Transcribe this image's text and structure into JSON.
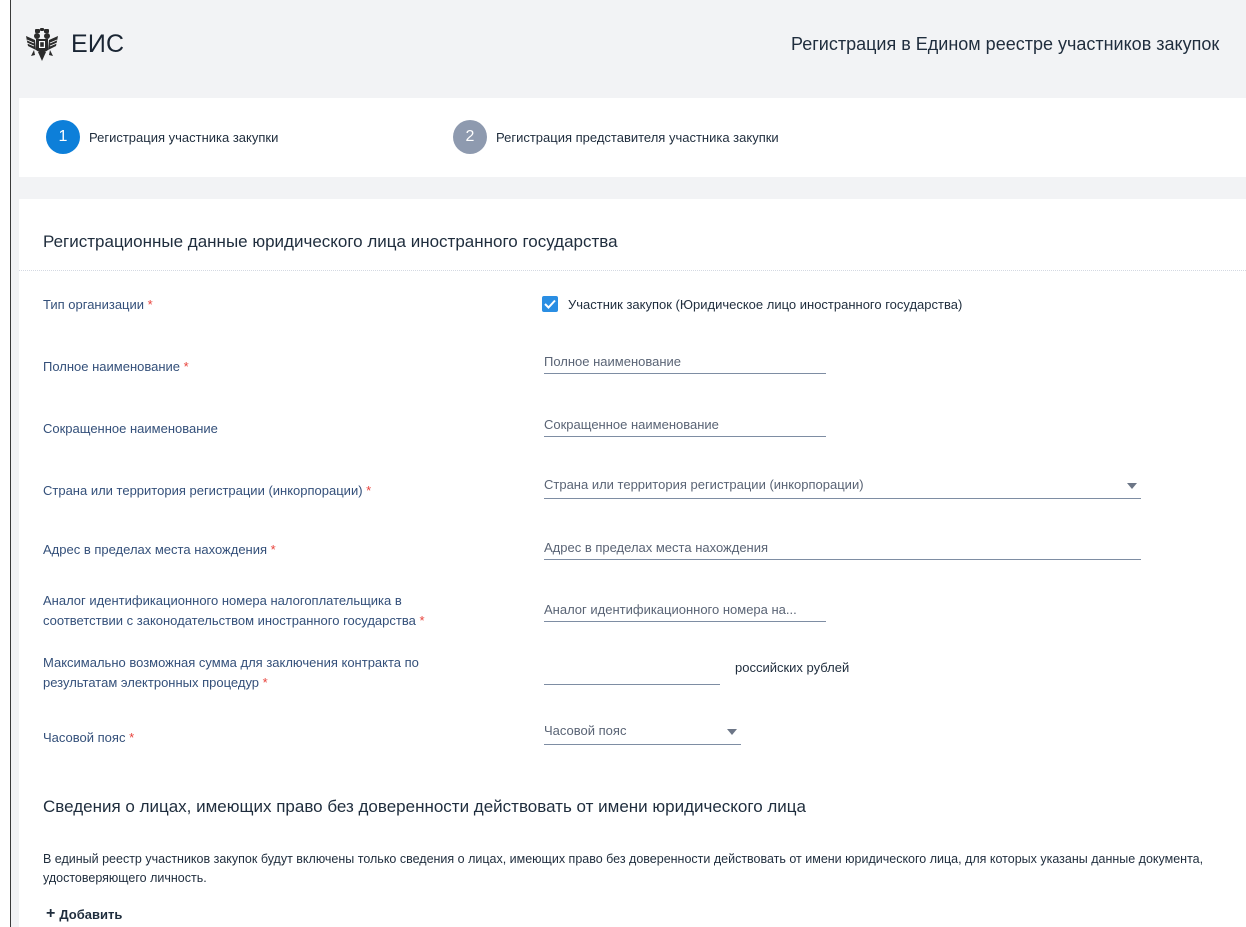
{
  "header": {
    "brand": "ЕИС",
    "page_title": "Регистрация в Едином реестре участников закупок",
    "logo_icon": "double-eagle-emblem-icon"
  },
  "steps": [
    {
      "number": "1",
      "label": "Регистрация участника закупки",
      "active": true
    },
    {
      "number": "2",
      "label": "Регистрация представителя участника закупки",
      "active": false
    }
  ],
  "form": {
    "section_title": "Регистрационные данные юридического лица иностранного государства",
    "required_mark": "*",
    "org_type": {
      "label": "Тип организации",
      "checkbox_label": "Участник закупок (Юридическое лицо иностранного государства)",
      "checked": true
    },
    "full_name": {
      "label": "Полное наименование",
      "placeholder": "Полное наименование"
    },
    "short_name": {
      "label": "Сокращенное наименование",
      "placeholder": "Сокращенное наименование"
    },
    "country": {
      "label": "Страна или территория регистрации (инкорпорации)",
      "placeholder": "Страна или территория регистрации (инкорпорации)"
    },
    "address": {
      "label": "Адрес в пределах места нахождения",
      "placeholder": "Адрес в пределах места нахождения"
    },
    "tax_id": {
      "label_line1": "Аналог идентификационного номера налогоплательщика в",
      "label_line2": "соответствии с законодательством иностранного государства",
      "placeholder": "Аналог идентификационного номера на..."
    },
    "max_sum": {
      "label_line1": "Максимально возможная сумма для заключения контракта по",
      "label_line2": "результатам электронных процедур",
      "value": "",
      "unit": "российских рублей"
    },
    "timezone": {
      "label": "Часовой пояс",
      "placeholder": "Часовой пояс"
    }
  },
  "persons_section": {
    "title": "Сведения о лицах, имеющих право без доверенности действовать от имени юридического лица",
    "note": "В единый реестр участников закупок будут включены только сведения о лицах, имеющих право без доверенности действовать от имени юридического лица, для которых указаны данные документа, удостоверяющего личность.",
    "add_label": "Добавить",
    "add_icon": "plus-icon"
  },
  "colors": {
    "accent": "#0d7fd9",
    "step_inactive": "#8e9aaf",
    "required": "#e8423b",
    "checkbox": "#2a8ee3",
    "background": "#f2f3f5"
  }
}
